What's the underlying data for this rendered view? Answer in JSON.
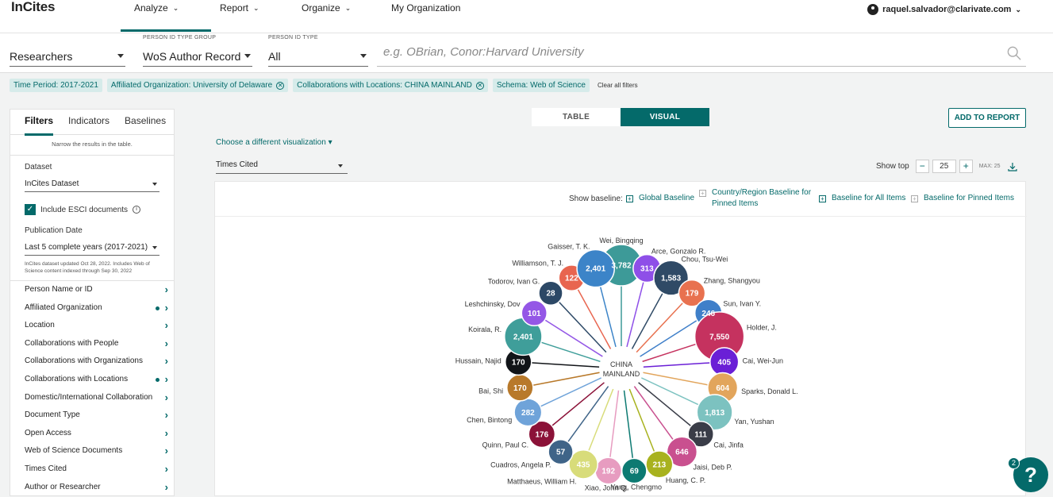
{
  "brand": "InCites",
  "nav": {
    "analyze": "Analyze",
    "report": "Report",
    "organize": "Organize",
    "my_org": "My Organization"
  },
  "user": "raquel.salvador@clarivate.com",
  "search": {
    "entity": "Researchers",
    "group_label": "PERSON ID TYPE GROUP",
    "group_value": "WoS Author Record",
    "type_label": "PERSON ID TYPE",
    "type_value": "All",
    "placeholder": "e.g. OBrian, Conor:Harvard University"
  },
  "filters": [
    {
      "label": "Time Period: 2017-2021",
      "removable": false
    },
    {
      "label": "Affiliated Organization: University of Delaware",
      "removable": true
    },
    {
      "label": "Collaborations with Locations: CHINA MAINLAND",
      "removable": true
    },
    {
      "label": "Schema: Web of Science",
      "removable": false
    }
  ],
  "clear_filters": "Clear all filters",
  "sidebar": {
    "tabs": [
      "Filters",
      "Indicators",
      "Baselines"
    ],
    "narrow": "Narrow the results in the table.",
    "dataset_label": "Dataset",
    "dataset_value": "InCites Dataset",
    "esci": "Include ESCI documents",
    "pub_label": "Publication Date",
    "pub_value": "Last 5 complete years (2017-2021)",
    "note": "InCites dataset updated Oct 28, 2022. Includes Web of Science content indexed through Sep 30, 2022",
    "items": [
      {
        "label": "Person Name or ID",
        "active": false
      },
      {
        "label": "Affiliated Organization",
        "active": true
      },
      {
        "label": "Location",
        "active": false
      },
      {
        "label": "Collaborations with People",
        "active": false
      },
      {
        "label": "Collaborations with Organizations",
        "active": false
      },
      {
        "label": "Collaborations with Locations",
        "active": true
      },
      {
        "label": "Domestic/International Collaboration",
        "active": false
      },
      {
        "label": "Document Type",
        "active": false
      },
      {
        "label": "Open Access",
        "active": false
      },
      {
        "label": "Web of Science Documents",
        "active": false
      },
      {
        "label": "Times Cited",
        "active": false
      },
      {
        "label": "Author or Researcher",
        "active": false
      }
    ]
  },
  "view": {
    "table": "TABLE",
    "visual": "VISUAL"
  },
  "add_to_report": "ADD TO REPORT",
  "choose_viz": "Choose a different visualization ▾",
  "metric": "Times Cited",
  "show_top": {
    "label": "Show top",
    "value": "25",
    "max": "MAX: 25"
  },
  "baseline": {
    "label": "Show baseline:",
    "global": "Global Baseline",
    "country_line1": "Country/Region Baseline for",
    "country_line2": "Pinned Items",
    "all_items": "Baseline for All Items",
    "pinned": "Baseline for Pinned Items"
  },
  "help_badge": "2",
  "chart_data": {
    "type": "radial-bubble",
    "center": [
      "CHINA",
      "MAINLAND"
    ],
    "nodes": [
      {
        "name": "Wei, Bingqing",
        "value": 3782,
        "label": "3,782",
        "color": "#3d9a98"
      },
      {
        "name": "Arce, Gonzalo R.",
        "value": 313,
        "label": "313",
        "color": "#8e4fe8"
      },
      {
        "name": "Chou, Tsu-Wei",
        "value": 1583,
        "label": "1,583",
        "color": "#2f4a66"
      },
      {
        "name": "Zhang, Shangyou",
        "value": 179,
        "label": "179",
        "color": "#e8714f"
      },
      {
        "name": "Sun, Ivan Y.",
        "value": 246,
        "label": "246",
        "color": "#3f7fc9"
      },
      {
        "name": "Holder, J.",
        "value": 7550,
        "label": "7,550",
        "color": "#c5325f"
      },
      {
        "name": "Cai, Wei-Jun",
        "value": 405,
        "label": "405",
        "color": "#6a1fd6"
      },
      {
        "name": "Sparks, Donald L.",
        "value": 604,
        "label": "604",
        "color": "#e2a55c"
      },
      {
        "name": "Yan, Yushan",
        "value": 1813,
        "label": "1,813",
        "color": "#7cc2c0"
      },
      {
        "name": "Cai, Jinfa",
        "value": 111,
        "label": "111",
        "color": "#3a3d48"
      },
      {
        "name": "Jaisi, Deb P.",
        "value": 646,
        "label": "646",
        "color": "#c9508f"
      },
      {
        "name": "Huang, C. P.",
        "value": 213,
        "label": "213",
        "color": "#a8b21e"
      },
      {
        "name": "Yang, Chengmo",
        "value": 69,
        "label": "69",
        "color": "#0d7a72"
      },
      {
        "name": "Xiao, John Q.",
        "value": 192,
        "label": "192",
        "color": "#e79cc0"
      },
      {
        "name": "Matthaeus, William H.",
        "value": 435,
        "label": "435",
        "color": "#d8dc7a"
      },
      {
        "name": "Cuadros, Angela P.",
        "value": 57,
        "label": "57",
        "color": "#3f6488"
      },
      {
        "name": "Quinn, Paul C.",
        "value": 176,
        "label": "176",
        "color": "#8b1238"
      },
      {
        "name": "Chen, Bintong",
        "value": 282,
        "label": "282",
        "color": "#6fa3d9"
      },
      {
        "name": "Bai, Shi",
        "value": 170,
        "label": "170",
        "color": "#b8792a"
      },
      {
        "name": "Hussain, Najid",
        "value": 170,
        "label": "170",
        "color": "#111418"
      },
      {
        "name": "Koirala, R.",
        "value": 2401,
        "label": "2,401",
        "color": "#3f9e9a"
      },
      {
        "name": "Leshchinsky, Dov",
        "value": 101,
        "label": "101",
        "color": "#9457e6"
      },
      {
        "name": "Todorov, Ivan G.",
        "value": 28,
        "label": "28",
        "color": "#2c4866"
      },
      {
        "name": "Williamson, T. J.",
        "value": 122,
        "label": "122",
        "color": "#e8654f"
      },
      {
        "name": "Gaisser, T. K.",
        "value": 2401,
        "label": "2,401",
        "color": "#3c84c8"
      }
    ]
  }
}
